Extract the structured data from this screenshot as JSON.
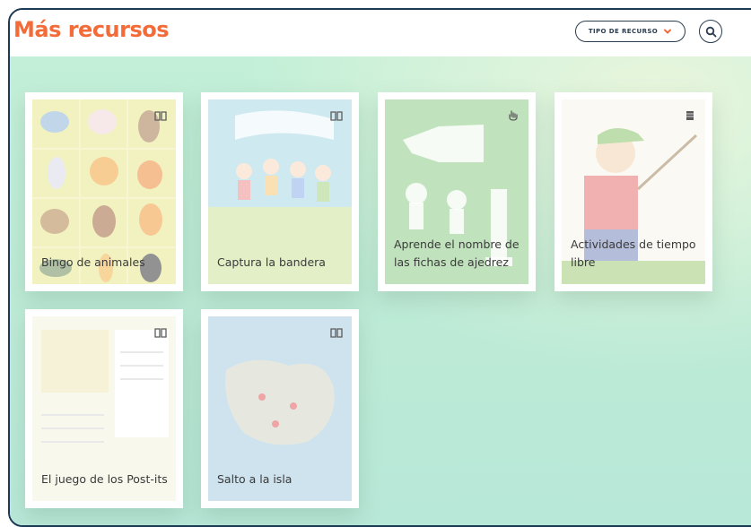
{
  "header": {
    "title": "Más recursos",
    "filter_label": "TIPO DE RECURSO",
    "accent_color": "#f26b38",
    "search_icon": "search-icon",
    "filter_icon": "chevron-down-icon"
  },
  "cards": [
    {
      "label": "Bingo de animales",
      "icon": "book-icon"
    },
    {
      "label": "Captura la bandera",
      "icon": "book-icon"
    },
    {
      "label": "Aprende el nombre de las fichas de ajedrez",
      "icon": "hand-icon"
    },
    {
      "label": "Actividades de tiempo libre",
      "icon": "stack-icon"
    },
    {
      "label": "El juego de los Post-its",
      "icon": "book-icon"
    },
    {
      "label": "Salto a la isla",
      "icon": "book-icon"
    }
  ]
}
